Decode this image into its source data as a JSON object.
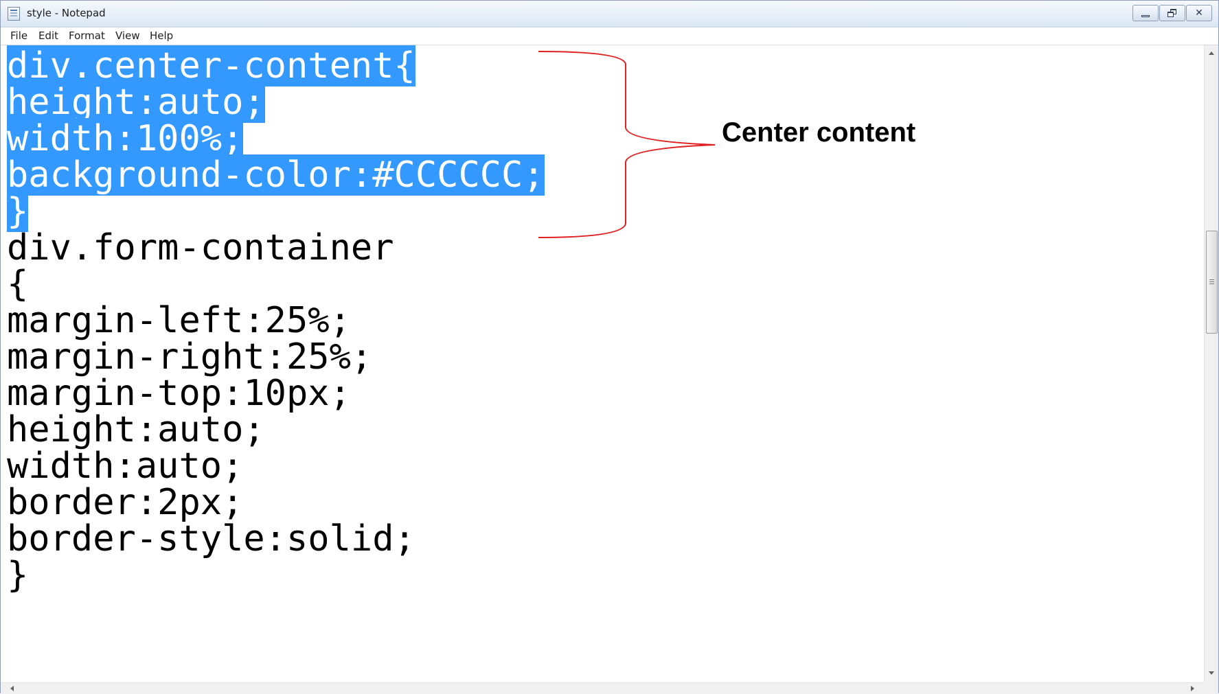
{
  "window": {
    "title": "style - Notepad",
    "icon": "notepad-icon",
    "controls": {
      "minimize": "minimize-icon",
      "maximize": "restore-icon",
      "close": "close-icon",
      "close_glyph": "✕"
    }
  },
  "menu": {
    "items": [
      {
        "label": "File"
      },
      {
        "label": "Edit"
      },
      {
        "label": "Format"
      },
      {
        "label": "View"
      },
      {
        "label": "Help"
      }
    ]
  },
  "editor": {
    "lines": [
      {
        "text": "div.center-content{",
        "selected": true
      },
      {
        "text": "height:auto;",
        "selected": true
      },
      {
        "text": "width:100%;",
        "selected": true
      },
      {
        "text": "background-color:#CCCCCC;",
        "selected": true
      },
      {
        "text": "}",
        "selected": true
      },
      {
        "text": "div.form-container",
        "selected": false
      },
      {
        "text": "{",
        "selected": false
      },
      {
        "text": "margin-left:25%;",
        "selected": false
      },
      {
        "text": "margin-right:25%;",
        "selected": false
      },
      {
        "text": "margin-top:10px;",
        "selected": false
      },
      {
        "text": "height:auto;",
        "selected": false
      },
      {
        "text": "width:auto;",
        "selected": false
      },
      {
        "text": "border:2px;",
        "selected": false
      },
      {
        "text": "border-style:solid;",
        "selected": false
      },
      {
        "text": "}",
        "selected": false
      }
    ],
    "selection_color": "#3399FF"
  },
  "annotation": {
    "label": "Center content",
    "brace_color": "#E02020"
  }
}
